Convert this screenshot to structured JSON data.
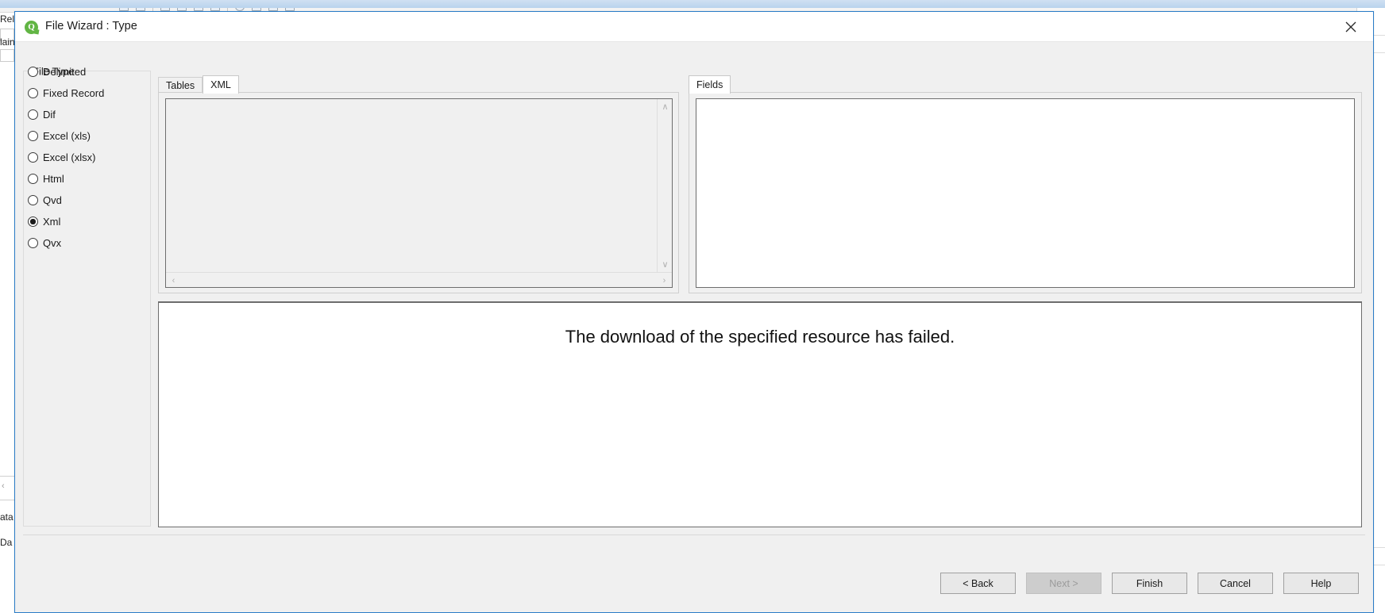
{
  "background": {
    "left_labels": [
      "Rel",
      "lain",
      "ata",
      "Da"
    ],
    "chevron": "‹"
  },
  "dialog": {
    "title": "File Wizard : Type",
    "app_icon": "qlik-leaf-icon",
    "close_icon": "close-icon",
    "file_type": {
      "legend": "File Type",
      "options": [
        {
          "label": "Delimited",
          "selected": false
        },
        {
          "label": "Fixed Record",
          "selected": false
        },
        {
          "label": "Dif",
          "selected": false
        },
        {
          "label": "Excel (xls)",
          "selected": false
        },
        {
          "label": "Excel (xlsx)",
          "selected": false
        },
        {
          "label": "Html",
          "selected": false
        },
        {
          "label": "Qvd",
          "selected": false
        },
        {
          "label": "Xml",
          "selected": true
        },
        {
          "label": "Qvx",
          "selected": false
        }
      ]
    },
    "left_tabs": [
      {
        "label": "Tables",
        "active": false
      },
      {
        "label": "XML",
        "active": true
      }
    ],
    "right_tabs": [
      {
        "label": "Fields",
        "active": true
      }
    ],
    "scroll": {
      "up_arrow": "∧",
      "down_arrow": "∨",
      "left_arrow": "‹",
      "right_arrow": "›"
    },
    "preview": {
      "message": "The download of the specified resource has failed."
    },
    "buttons": [
      {
        "label": "< Back",
        "disabled": false
      },
      {
        "label": "Next >",
        "disabled": true
      },
      {
        "label": "Finish",
        "disabled": false
      },
      {
        "label": "Cancel",
        "disabled": false
      },
      {
        "label": "Help",
        "disabled": false
      }
    ]
  },
  "colors": {
    "dialog_border": "#2a7cc7",
    "accent_green": "#62b544",
    "dialog_bg": "#f0f0f0"
  }
}
